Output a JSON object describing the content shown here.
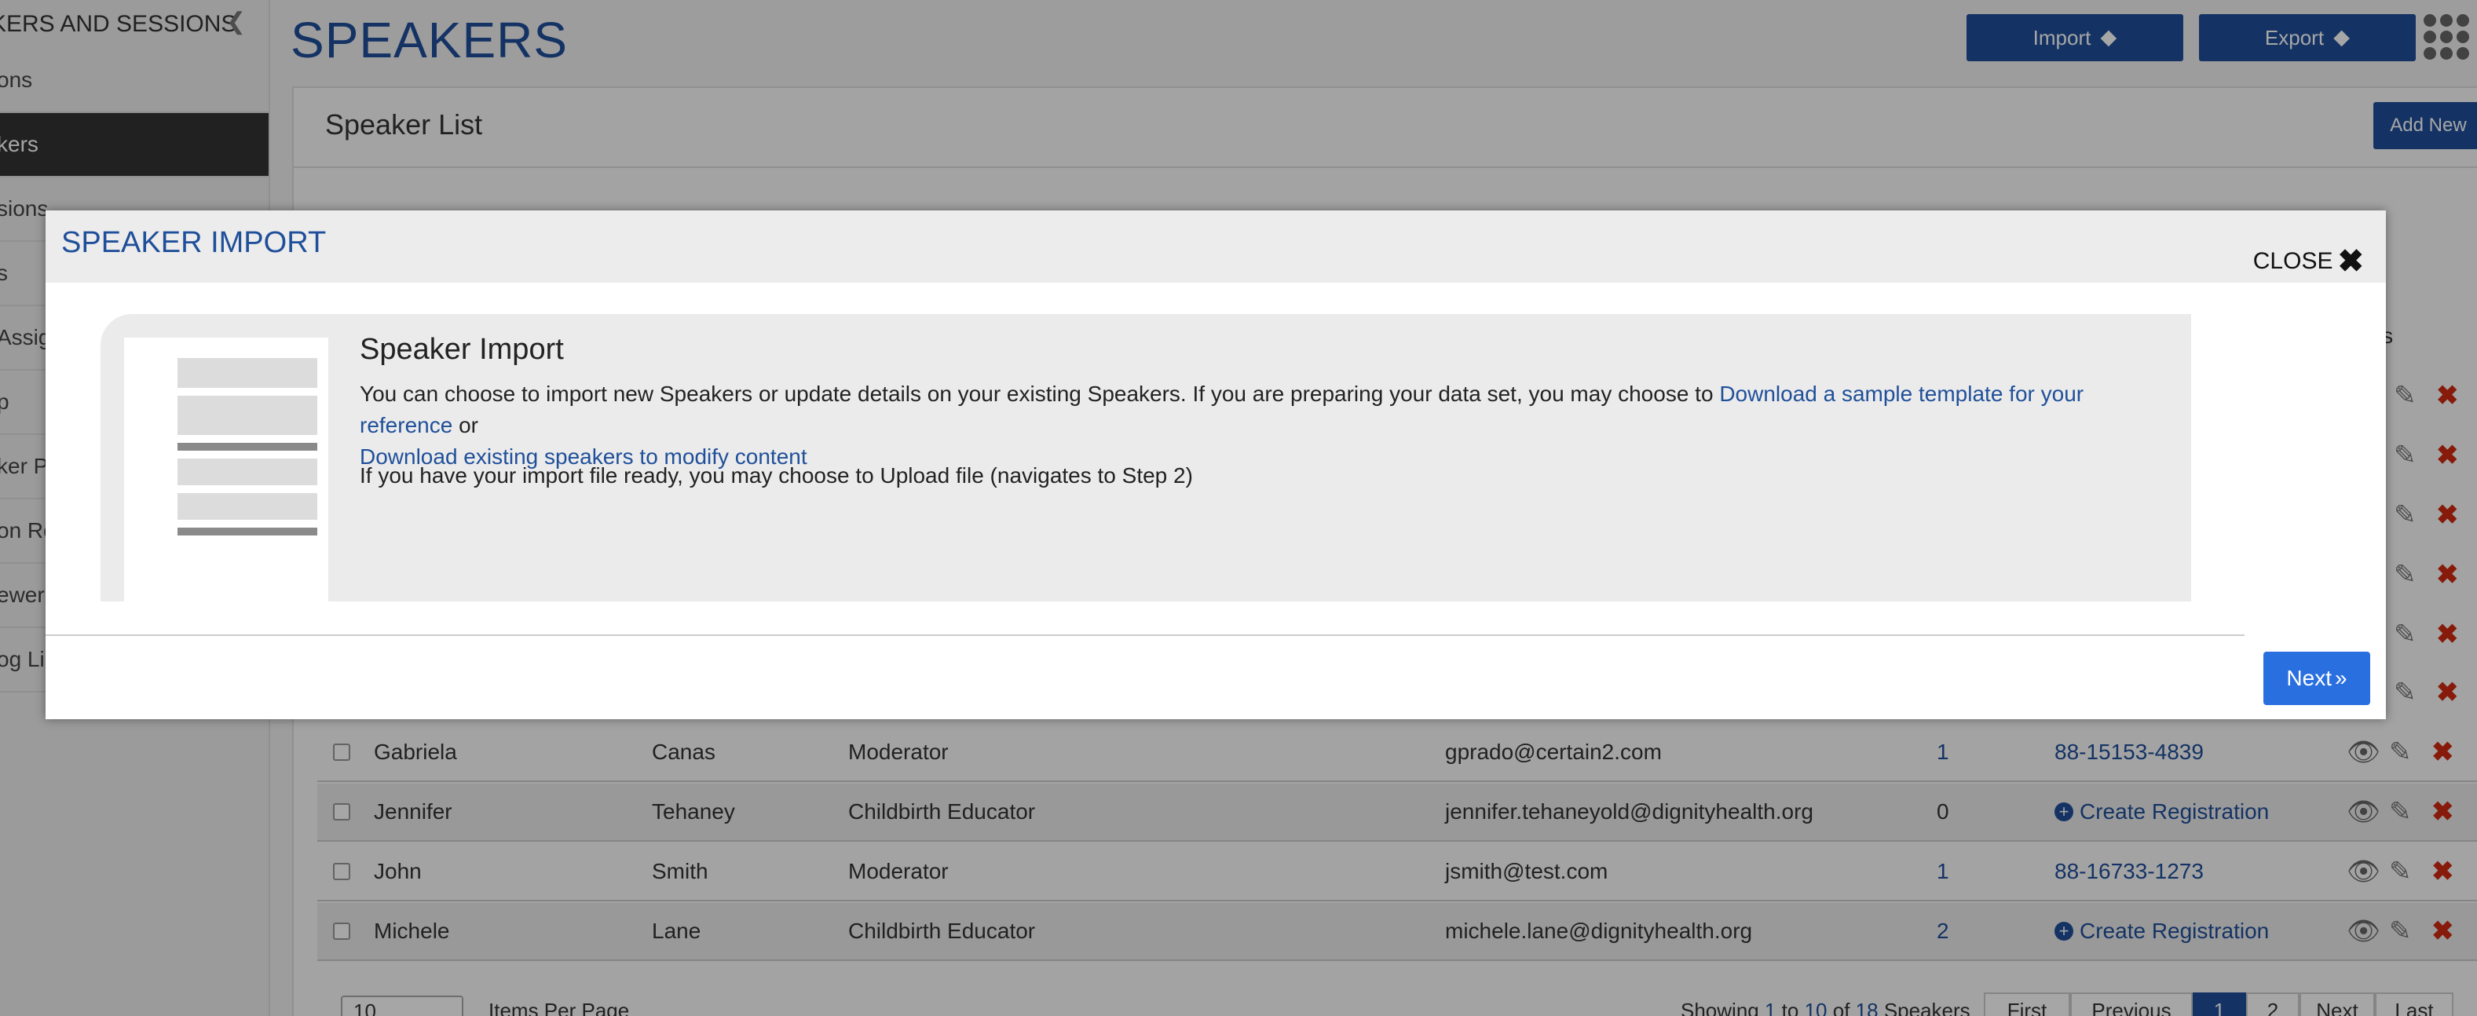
{
  "sidebar": {
    "header": "KERS AND SESSIONS",
    "items": [
      {
        "label": "ons",
        "active": false
      },
      {
        "label": "kers",
        "active": true
      },
      {
        "label": "sions",
        "active": false
      },
      {
        "label": "s",
        "active": false
      },
      {
        "label": "Assig",
        "active": false
      },
      {
        "label": "p",
        "active": false
      },
      {
        "label": "ker Po",
        "active": false
      },
      {
        "label": "on Re",
        "active": false
      },
      {
        "label": "ewer",
        "active": false
      },
      {
        "label": "og Li",
        "active": false
      }
    ]
  },
  "header": {
    "title": "SPEAKERS",
    "import_label": "Import",
    "export_label": "Export"
  },
  "panel": {
    "title": "Speaker List",
    "add_new_label": "Add New",
    "actions_header": "ons"
  },
  "rows": [
    {
      "first": "Gabriela",
      "last": "Canas",
      "role": "Moderator",
      "email": "gprado@certain2.com",
      "count": "1",
      "registration": "88-15153-4839",
      "is_create": false
    },
    {
      "first": "Jennifer",
      "last": "Tehaney",
      "role": "Childbirth Educator",
      "email": "jennifer.tehaneyold@dignityhealth.org",
      "count": "0",
      "registration": "Create Registration",
      "is_create": true
    },
    {
      "first": "John",
      "last": "Smith",
      "role": "Moderator",
      "email": "jsmith@test.com",
      "count": "1",
      "registration": "88-16733-1273",
      "is_create": false
    },
    {
      "first": "Michele",
      "last": "Lane",
      "role": "Childbirth Educator",
      "email": "michele.lane@dignityhealth.org",
      "count": "2",
      "registration": "Create Registration",
      "is_create": true
    }
  ],
  "pagination": {
    "items_per_page_value": "10",
    "items_per_page_label": "Items Per Page",
    "showing_prefix": "Showing",
    "from": "1",
    "to_word": "to",
    "to": "10",
    "of_word": "of",
    "total": "18",
    "suffix": "Speakers",
    "first": "First",
    "previous": "Previous",
    "page1": "1",
    "page2": "2",
    "next": "Next",
    "last": "Last"
  },
  "modal": {
    "title": "SPEAKER IMPORT",
    "close_label": "CLOSE",
    "heading": "Speaker Import",
    "text_part1": "You can choose to import new Speakers or update details on your existing Speakers. If you are preparing your data set, you may choose to",
    "link_template": "Download a sample template for your reference",
    "text_or": "or",
    "link_existing": "Download existing speakers to modify content",
    "text_upload": "If you have your import file ready, you may choose to Upload file (navigates to Step 2)",
    "next_label": "Next"
  },
  "colors": {
    "brand_blue": "#1f4f9a",
    "next_button": "#2a6fe0",
    "delete_red": "#d02a12",
    "sidebar_active": "#333333"
  },
  "icons": [
    "chevron-left-icon",
    "upload-icon",
    "apps-grid-icon",
    "close-icon",
    "eye-icon",
    "pencil-icon",
    "delete-icon",
    "plus-circle-icon",
    "double-chevron-right-icon"
  ]
}
